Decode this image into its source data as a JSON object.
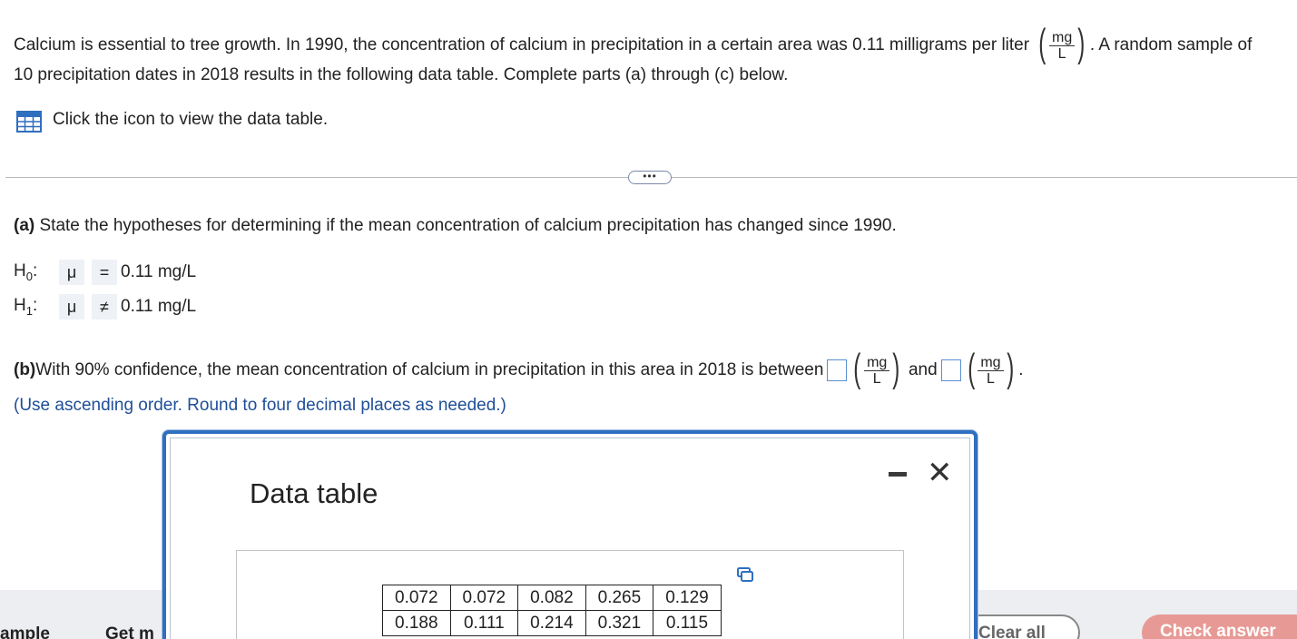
{
  "intro": {
    "line1_part1": "Calcium is essential to tree growth. In 1990, the concentration of calcium in precipitation in a certain area was 0.11 milligrams per liter",
    "unit_num": "mg",
    "unit_den": "L",
    "line1_part2": ". A random sample of",
    "line2": "10 precipitation dates in 2018 results in the following data table. Complete parts (a) through (c) below."
  },
  "data_link": {
    "icon": "grid-icon",
    "text": "Click the icon to view the data table."
  },
  "divider": {
    "more_label": "•••"
  },
  "part_a": {
    "label": "(a)",
    "text": " State the hypotheses for determining if the mean concentration of calcium precipitation has changed since 1990.",
    "h0": {
      "label": "H",
      "sub": "0",
      "colon": ":",
      "param": "μ",
      "op": "=",
      "value": "0.11 mg/L"
    },
    "h1": {
      "label": "H",
      "sub": "1",
      "colon": ":",
      "param": "μ",
      "op": "≠",
      "value": "0.11 mg/L"
    }
  },
  "part_b": {
    "label": "(b)",
    "text": " With 90% confidence, the mean concentration of calcium in precipitation in this area in 2018 is between",
    "and": "and",
    "unit_num": "mg",
    "unit_den": "L",
    "end": ".",
    "hint": "(Use ascending order. Round to four decimal places as needed.)"
  },
  "modal": {
    "title": "Data table",
    "copy_icon": "copy-icon",
    "rows": [
      [
        "0.072",
        "0.072",
        "0.082",
        "0.265",
        "0.129"
      ],
      [
        "0.188",
        "0.111",
        "0.214",
        "0.321",
        "0.115"
      ]
    ]
  },
  "bottom_bar": {
    "sample": "ample",
    "get": "Get m",
    "clear": "Clear all",
    "check": "Check answer"
  }
}
